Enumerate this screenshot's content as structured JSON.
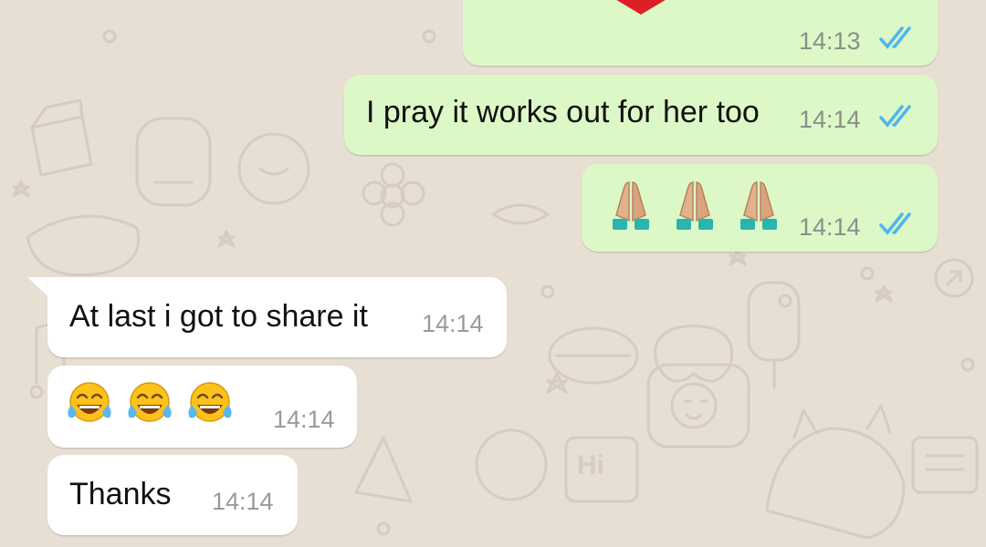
{
  "colors": {
    "background": "#e7ded4",
    "outgoing_bubble": "#dcf8c6",
    "incoming_bubble": "#ffffff",
    "read_ticks": "#4fb6ec",
    "doodle": "#d6ccc0"
  },
  "messages": [
    {
      "direction": "outgoing",
      "kind": "image-tail",
      "icon": "heart-icon",
      "time": "14:13",
      "status": "read"
    },
    {
      "direction": "outgoing",
      "kind": "text",
      "text": "I pray it works out for her too",
      "time": "14:14",
      "status": "read"
    },
    {
      "direction": "outgoing",
      "kind": "emoji",
      "icons": [
        "praying-hands-icon",
        "praying-hands-icon",
        "praying-hands-icon"
      ],
      "time": "14:14",
      "status": "read"
    },
    {
      "direction": "incoming",
      "kind": "text",
      "text": "At last i got to share it",
      "time": "14:14"
    },
    {
      "direction": "incoming",
      "kind": "emoji",
      "icons": [
        "tears-of-joy-icon",
        "tears-of-joy-icon",
        "tears-of-joy-icon"
      ],
      "time": "14:14"
    },
    {
      "direction": "incoming",
      "kind": "text",
      "text": "Thanks",
      "time": "14:14"
    }
  ],
  "wallpaper_doodles": {
    "hi_sign": "Hi"
  }
}
